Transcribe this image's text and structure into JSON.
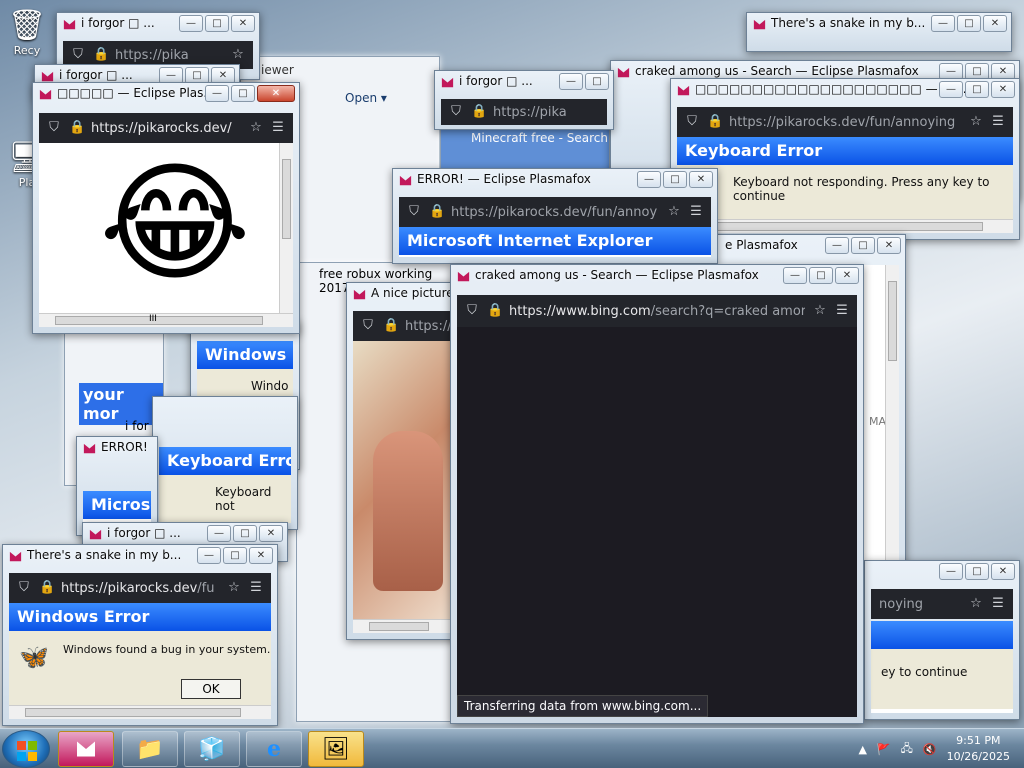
{
  "colors": {
    "accent": "#0a52e6",
    "titlebar_close": "#c9452d",
    "toolbar": "#23252b",
    "favicon": "#c2185b"
  },
  "desktop": {
    "recycle_label": "Recy",
    "shortcut_label": "Pla"
  },
  "ghosts": {
    "viewer_label": "iewer",
    "open_label": "Open",
    "minecraft_title": "Minecraft free - Search",
    "free_robux_title": "free robux working 2017",
    "your_mom_text": "your mor",
    "ife_text": "i for"
  },
  "win_smiley": {
    "title": "□□□□□ — Eclipse Plas...",
    "url_domain": "https://pikarocks.dev/",
    "page_glyph": "😂",
    "scroll_label": "III"
  },
  "win_iforgor_a": {
    "title": "i forgor □ ...",
    "url": "https://pika"
  },
  "win_iforgor_b": {
    "title": "i forgor □ ...",
    "url": "https://pika"
  },
  "win_craked_top": {
    "title": "craked among us - Search — Eclipse Plasmafox"
  },
  "win_keyboard": {
    "title": "□□□□□□□□□□□□□□□□□□□□ — Ecl...",
    "url": "https://pikarocks.dev/fun/annoying",
    "dialog_title": "Keyboard Error",
    "message": "Keyboard not responding. Press any key to continue",
    "scroll_label": "III"
  },
  "win_snake_top": {
    "title": "There's a snake in my b..."
  },
  "win_error_ie": {
    "title": "ERROR! — Eclipse Plasmafox",
    "url": "https://pikarocks.dev/fun/annoy",
    "dialog_title": "Microsoft Internet Explorer"
  },
  "win_plasmafox_right": {
    "title": "e Plasmafox",
    "map_label": "MAP"
  },
  "win_nice_picture": {
    "title": "A nice picture",
    "url": "https://",
    "scroll_label": "III"
  },
  "win_windows_error_mid": {
    "dialog_title": "Windows Er",
    "text": "Windo"
  },
  "win_keyboard_mid": {
    "dialog_title": "Keyboard Error",
    "text": "Keyboard not"
  },
  "win_error_ms": {
    "title": "ERROR!",
    "dialog_title": "Microso"
  },
  "win_iforgor_c": {
    "title": "i forgor □ ..."
  },
  "win_main": {
    "title": "craked among us - Search — Eclipse Plasmafox",
    "url_domain": "https://www.bing.com",
    "url_path": "/search?q=craked amor",
    "status": "Transferring data from www.bing.com..."
  },
  "win_snake_bottom": {
    "title": "There's a snake in my b...",
    "url_domain": "https://pikarocks.dev",
    "url_path": "/fu",
    "dialog_title": "Windows Error",
    "message": "Windows found a bug in your system.",
    "ok_label": "OK",
    "scroll_label": "III"
  },
  "win_bottom_right": {
    "url_tail": "noying",
    "message": "ey to continue"
  },
  "taskbar": {
    "time": "9:51 PM",
    "date": "10/26/2025"
  }
}
